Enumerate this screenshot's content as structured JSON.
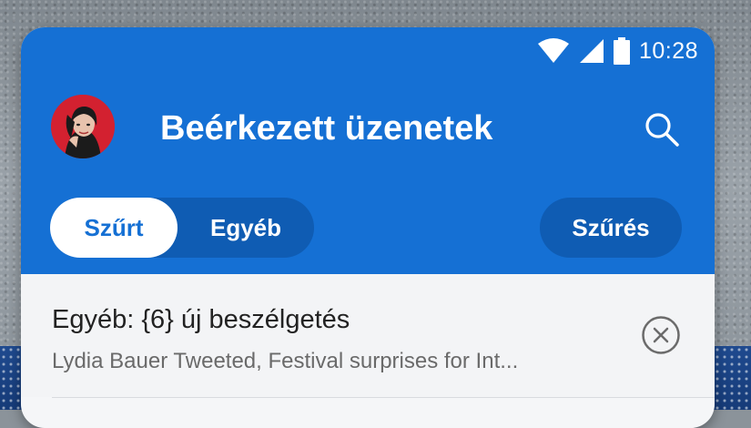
{
  "status_bar": {
    "time": "10:28",
    "icons": [
      "wifi-icon",
      "signal-icon",
      "battery-icon"
    ]
  },
  "header": {
    "title": "Beérkezett üzenetek",
    "avatar": "avatar",
    "search_icon": "search-icon",
    "accent_color": "#1570d4"
  },
  "tabs": {
    "focused_label": "Szűrt",
    "other_label": "Egyéb",
    "filter_label": "Szűrés"
  },
  "notice": {
    "title": "Egyéb: {6} új beszélgetés",
    "subtitle": "Lydia Bauer Tweeted, Festival surprises for Int...",
    "close_icon": "close-circle-icon"
  }
}
